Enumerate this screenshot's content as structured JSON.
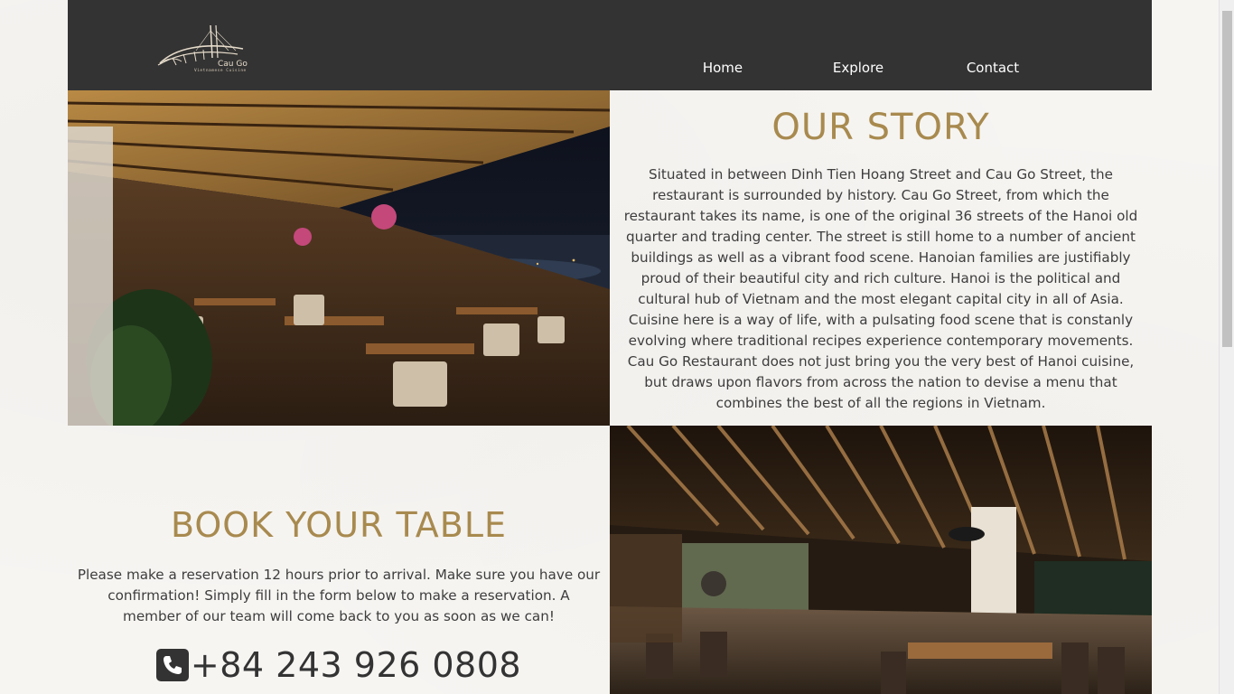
{
  "brand": {
    "name": "Cau Go",
    "tagline": "Vietnamese Cuisine"
  },
  "nav": {
    "items": [
      {
        "label": "Home"
      },
      {
        "label": "Explore"
      },
      {
        "label": "Contact"
      }
    ]
  },
  "story": {
    "title": "OUR STORY",
    "text": "Situated in between Dinh Tien Hoang Street and Cau Go Street, the restaurant is surrounded by history. Cau Go Street, from which the restaurant takes its name, is one of the original 36 streets of the Hanoi old quarter and trading center. The street is still home to a number of ancient buildings as well as a vibrant food scene. Hanoian families are justifiably proud of their beautiful city and rich culture. Hanoi is the political and cultural hub of Vietnam and the most elegant capital city in all of Asia. Cuisine here is a way of life, with a pulsating food scene that is constanly evolving where traditional recipes experience contemporary movements. Cau Go Restaurant does not just bring you the very best of Hanoi cuisine, but draws upon flavors from across the nation to devise a menu that combines the best of all the regions in Vietnam."
  },
  "booking": {
    "title": "BOOK YOUR TABLE",
    "text": "Please make a reservation 12 hours prior to arrival. Make sure you have our confirmation! Simply fill in the form below to make a reservation. A member of our team will come back to you as soon as we can!",
    "phone": "+84 243 926 0808"
  },
  "colors": {
    "header_bg": "#333333",
    "accent_gold": "#a88a4f",
    "body_text": "#3d3d3d",
    "page_bg": "#f7f5f2"
  },
  "icons": [
    "logo-bridge-icon",
    "phone-icon"
  ]
}
